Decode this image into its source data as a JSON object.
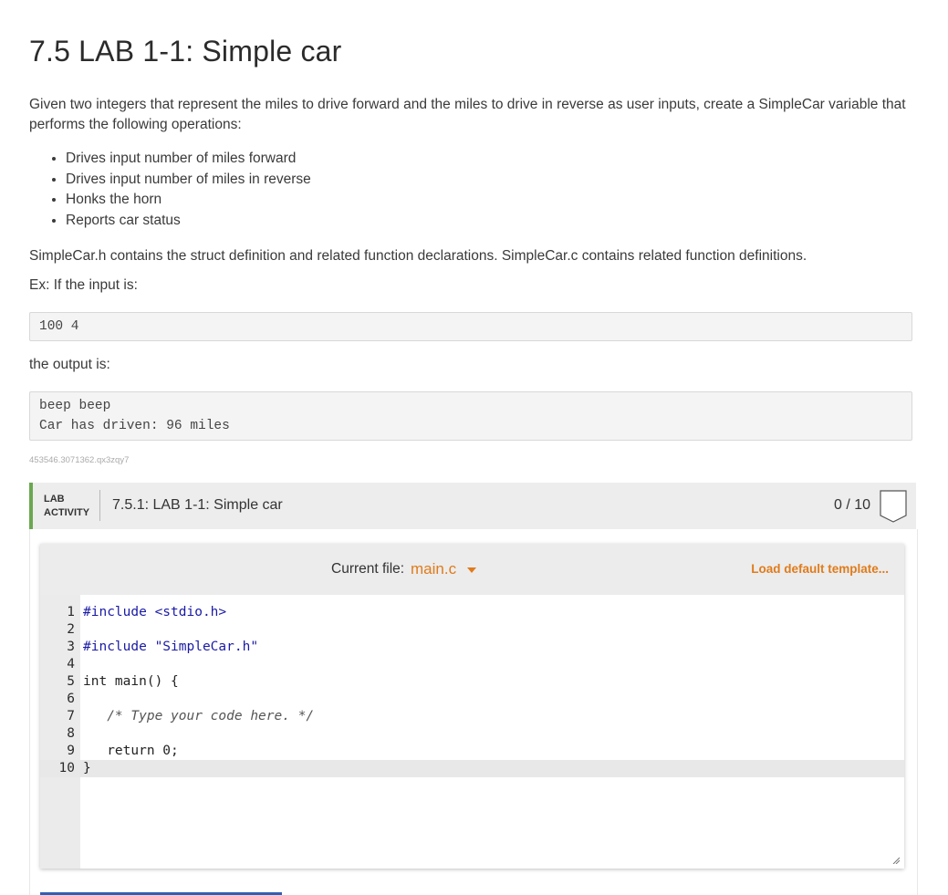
{
  "title": "7.5 LAB 1-1: Simple car",
  "intro": "Given two integers that represent the miles to drive forward and the miles to drive in reverse as user inputs, create a SimpleCar variable that performs the following operations:",
  "bullets": [
    "Drives input number of miles forward",
    "Drives input number of miles in reverse",
    "Honks the horn",
    "Reports car status"
  ],
  "files_note": "SimpleCar.h contains the struct definition and related function declarations. SimpleCar.c contains related function definitions.",
  "example_intro": "Ex: If the input is:",
  "example_input": [
    "100 4"
  ],
  "output_intro": "the output is:",
  "example_output": [
    "beep beep",
    "Car has driven: 96 miles"
  ],
  "tag_id": "453546.3071362.qx3zqy7",
  "lab": {
    "label_line1": "LAB",
    "label_line2": "ACTIVITY",
    "title": "7.5.1: LAB 1-1: Simple car",
    "score": "0 / 10"
  },
  "editor": {
    "current_file_label": "Current file:",
    "current_file": "main.c",
    "load_default": "Load default template...",
    "line_numbers": [
      "1",
      "2",
      "3",
      "4",
      "5",
      "6",
      "7",
      "8",
      "9",
      "10"
    ],
    "lines": [
      "#include <stdio.h>",
      "",
      "#include \"SimpleCar.h\"",
      "",
      "int main() {",
      "",
      "   /* Type your code here. */",
      "",
      "   return 0;",
      "}"
    ]
  },
  "colors": {
    "accent_orange": "#e07b1b",
    "lab_green": "#6aa84f",
    "keyword_blue": "#1a1aa6",
    "number_green": "#098658"
  }
}
